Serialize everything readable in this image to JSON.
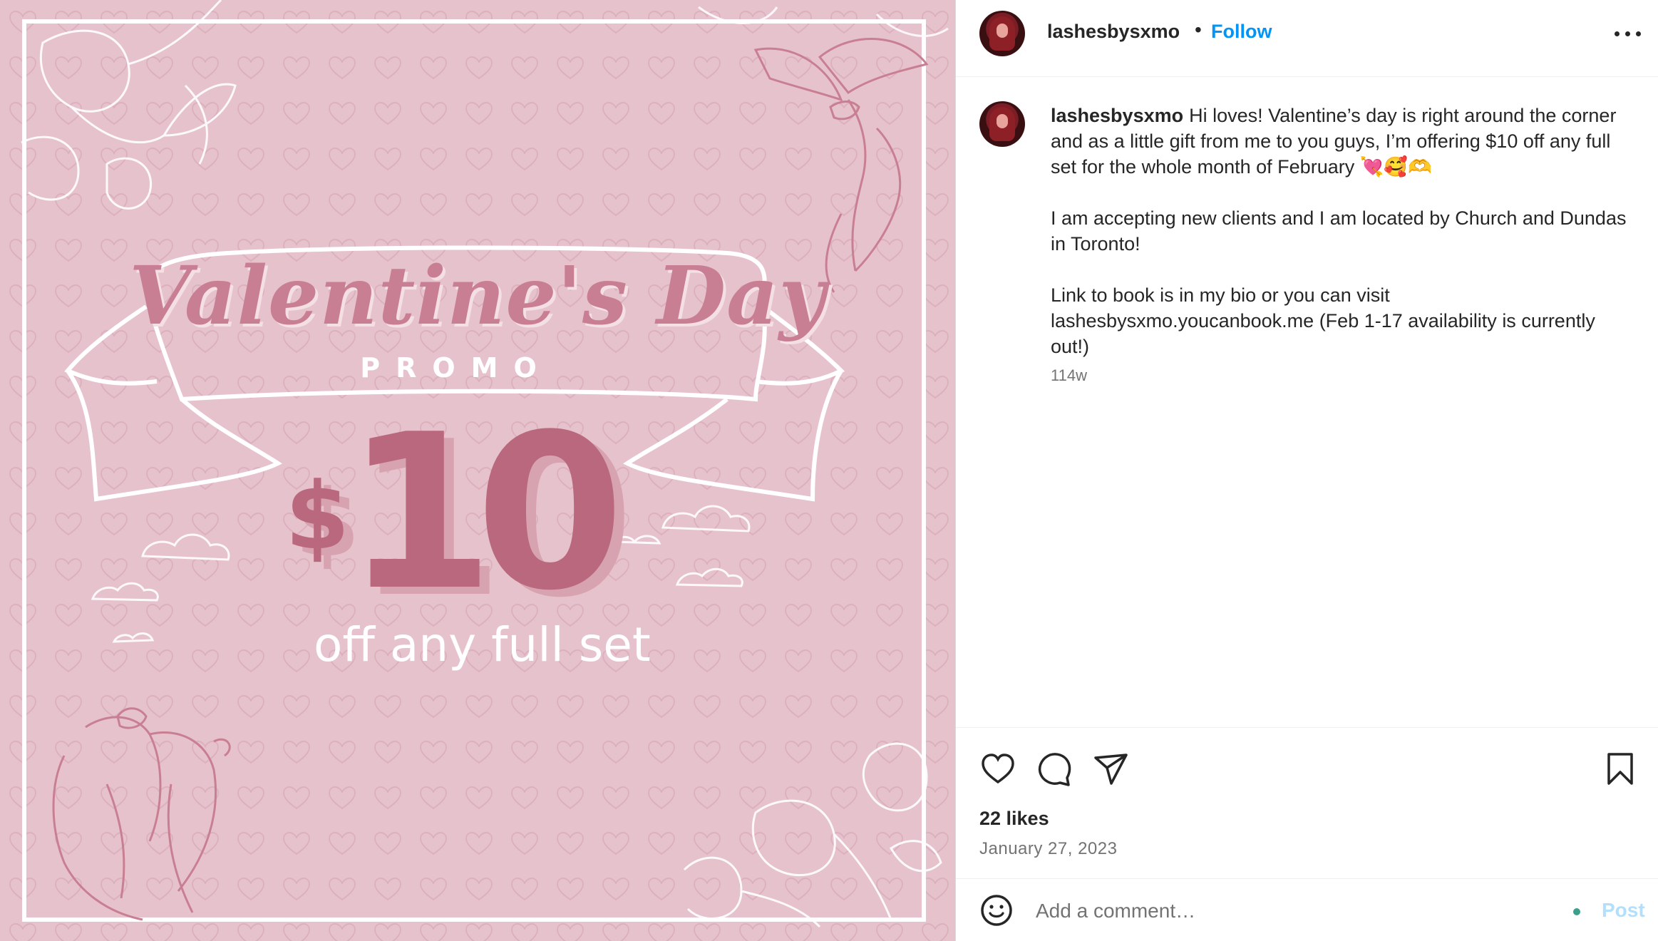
{
  "image": {
    "script_title": "Valentine's Day",
    "subtitle": "PROMO",
    "currency": "$",
    "amount": "10",
    "offer": "off any full set",
    "colors": {
      "background": "#e6c2cc",
      "accent": "#b9687d",
      "line": "#ffffff"
    }
  },
  "header": {
    "username": "lashesbysxmo",
    "separator": "•",
    "follow_label": "Follow",
    "more_icon": "more-horizontal-icon"
  },
  "caption": {
    "username": "lashesbysxmo",
    "paragraph1": "Hi loves! Valentine’s day is right around the corner and as a little gift from me to you guys, I’m offering $10 off any full set for the whole month of February 💘🥰🫶",
    "paragraph2": "I am accepting new clients and I am located by Church and Dundas in Toronto!",
    "paragraph3": "Link to book is in my bio or you can visit lashesbysxmo.youcanbook.me (Feb 1-17 availability is currently out!)",
    "time_ago": "114w"
  },
  "actions": {
    "icons": [
      "heart-icon",
      "comment-icon",
      "share-icon",
      "bookmark-icon"
    ],
    "likes": "22 likes",
    "date": "January 27, 2023"
  },
  "comment_bar": {
    "emoji_icon": "smiley-icon",
    "placeholder": "Add a comment…",
    "post_label": "Post"
  }
}
